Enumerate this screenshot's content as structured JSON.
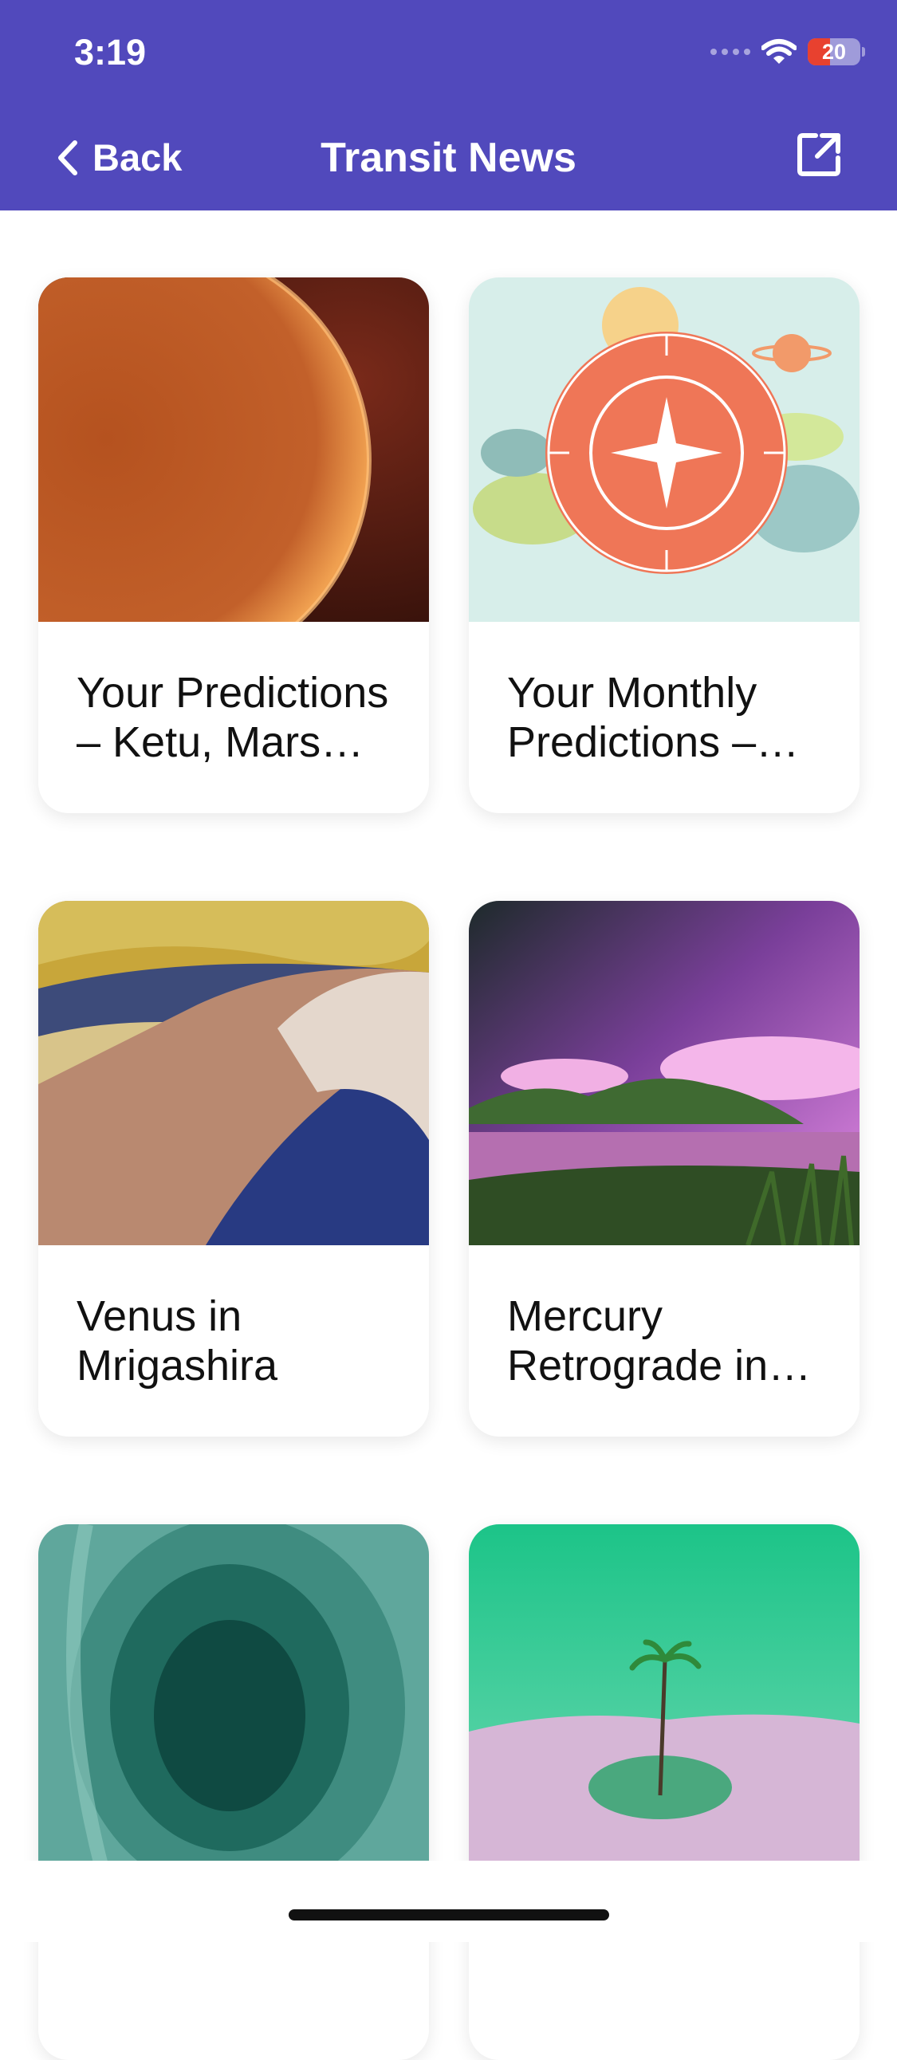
{
  "status_bar": {
    "time": "3:19",
    "battery": "20"
  },
  "header": {
    "back_label": "Back",
    "title": "Transit News"
  },
  "colors": {
    "header_bg": "#5149BC",
    "battery_low": "#E8412F"
  },
  "icons": {
    "back": "chevron-left-icon",
    "share": "share-icon",
    "wifi": "wifi-icon"
  },
  "articles": [
    {
      "title": "Your Predictions – Ketu, Mars…"
    },
    {
      "title": "Your Monthly Predictions –…"
    },
    {
      "title": "Venus in Mrigashira"
    },
    {
      "title": "Mercury Retrograde in…"
    },
    {
      "title": ""
    },
    {
      "title": ""
    }
  ]
}
